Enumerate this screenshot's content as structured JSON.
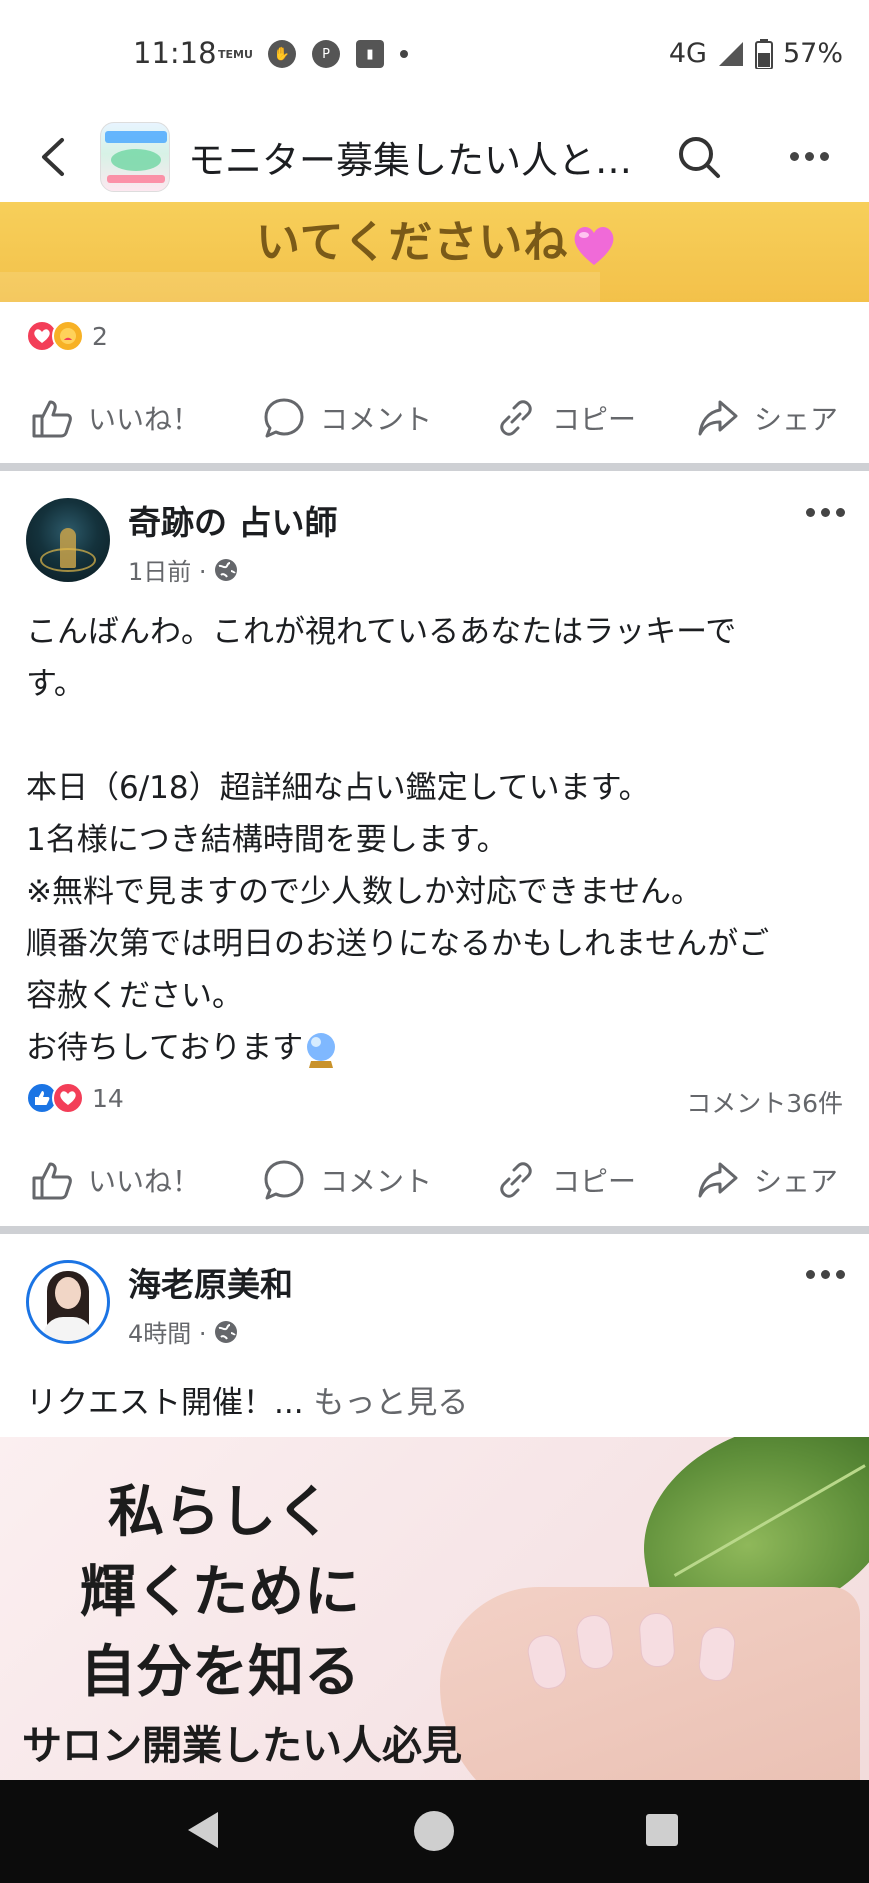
{
  "status_bar": {
    "time": "11:18",
    "temu_label": "TEMU",
    "network": "4G",
    "battery": "57%"
  },
  "app_bar": {
    "title": "モニター募集したい人と…"
  },
  "prev_post": {
    "banner_text": "いてくださいね",
    "reaction_count": "2",
    "actions": {
      "like": "いいね！",
      "comment": "コメント",
      "copy": "コピー",
      "share": "シェア"
    }
  },
  "post1": {
    "author": "奇跡の 占い師",
    "time": "1日前 ·",
    "body_lines": [
      "こんばんわ。これが視れているあなたはラッキーで",
      "す。",
      "",
      "本日（6/18）超詳細な占い鑑定しています。",
      "1名様につき結構時間を要します。",
      "※無料で見ますので少人数しか対応できません。",
      "順番次第では明日のお送りになるかもしれませんがご",
      "容赦ください。",
      "お待ちしております"
    ],
    "reaction_count": "14",
    "comment_count": "コメント36件",
    "actions": {
      "like": "いいね！",
      "comment": "コメント",
      "copy": "コピー",
      "share": "シェア"
    }
  },
  "post2": {
    "author": "海老原美和",
    "time": "4時間 ·",
    "snippet": "リクエスト開催！...",
    "see_more": "もっと見る",
    "promo": {
      "line1": "私らしく",
      "line2": "輝くために",
      "line3": "自分を知る",
      "subline": "サロン開業したい人必見"
    }
  },
  "colors": {
    "banner": "#f3c14a",
    "like_blue": "#1b74e4",
    "love_red": "#f33e58",
    "muted_text": "#65676b"
  }
}
